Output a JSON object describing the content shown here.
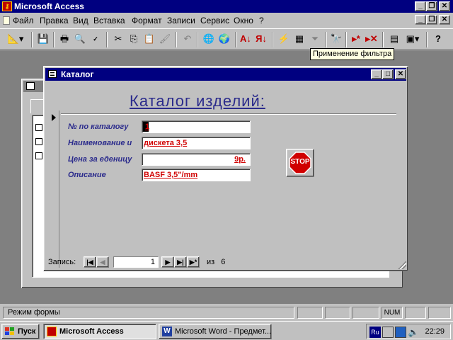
{
  "app": {
    "title": "Microsoft Access"
  },
  "menu": [
    "Файл",
    "Правка",
    "Вид",
    "Вставка",
    "Формат",
    "Записи",
    "Сервис",
    "Окно",
    "?"
  ],
  "tooltip": "Применение фильтра",
  "form_window": {
    "title": "Каталог",
    "heading": "Каталог изделий:",
    "fields": [
      {
        "label": "№ по каталогу",
        "value": "1"
      },
      {
        "label": "Наименование и",
        "value": "дискета  3,5"
      },
      {
        "label": "Цена за еденицу",
        "value": "9р."
      },
      {
        "label": "Описание",
        "value": "BASF  3,5\"/mm"
      }
    ],
    "stop_label": "STOP"
  },
  "record_nav": {
    "label": "Запись:",
    "current": "1",
    "of_label": "из",
    "total": "6"
  },
  "statusbar": {
    "text": "Режим формы",
    "num": "NUM"
  },
  "taskbar": {
    "start": "Пуск",
    "tasks": [
      "Microsoft Access",
      "Microsoft Word - Предмет..."
    ],
    "lang": "Ru",
    "time": "22:29"
  },
  "colors": {
    "titlebar": "#000080",
    "form_text": "#2b2b8c",
    "field_value": "#d00000",
    "stop_sign": "#d00000"
  }
}
